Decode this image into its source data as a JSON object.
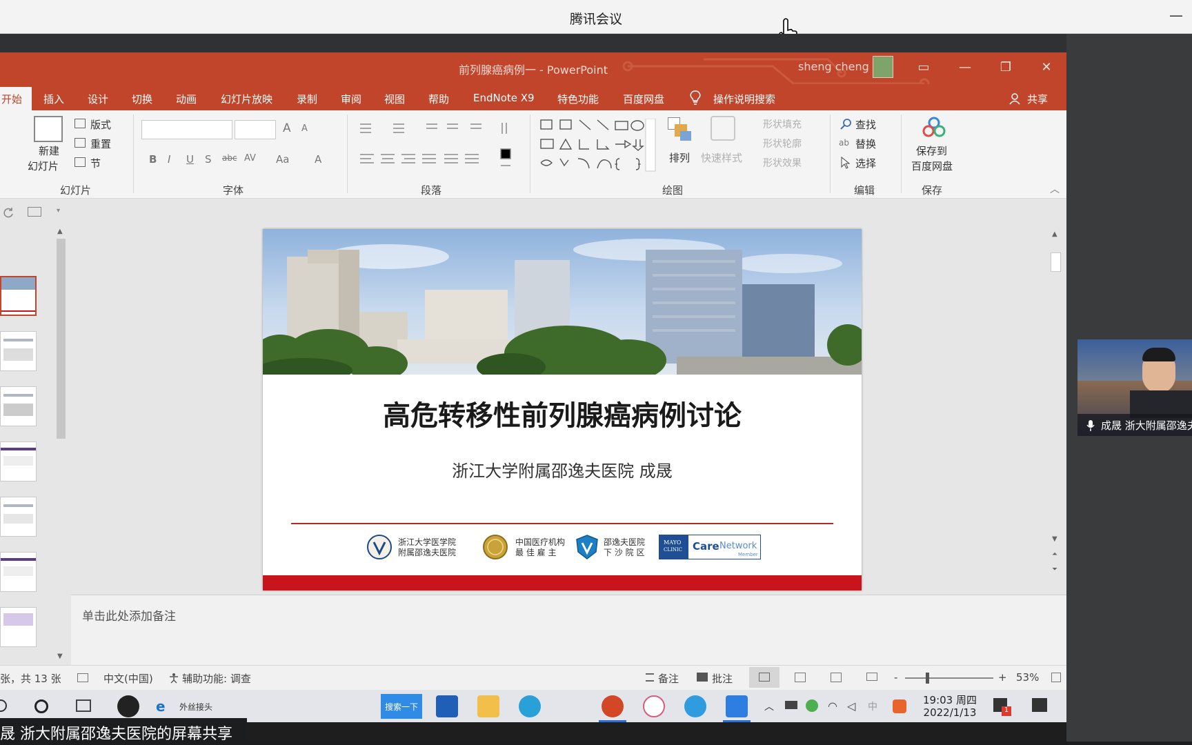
{
  "meeting": {
    "title": "腾讯会议",
    "share_banner": "晟 浙大附属邵逸夫医院的屏幕共享",
    "minimize_symbol": "—"
  },
  "window": {
    "title": "前列腺癌病例一 - PowerPoint",
    "user": "sheng cheng",
    "controls": [
      "▭",
      "—",
      "❐",
      "✕"
    ]
  },
  "tabs": [
    "开始",
    "插入",
    "设计",
    "切换",
    "动画",
    "幻灯片放映",
    "录制",
    "审阅",
    "视图",
    "帮助",
    "EndNote X9",
    "特色功能",
    "百度网盘"
  ],
  "tell_me": "操作说明搜索",
  "share_button": "共享",
  "ribbon": {
    "slides": {
      "label": "幻灯片",
      "new_slide": "新建",
      "new_slide_2": "幻灯片",
      "layout": "版式",
      "reset": "重置",
      "section": "节"
    },
    "font": {
      "label": "字体",
      "bold": "B",
      "italic": "I",
      "underline": "U",
      "shadow": "S",
      "strike": "abc",
      "spacing": "AV",
      "case": "Aa",
      "color": "A",
      "grow": "A",
      "shrink": "A"
    },
    "paragraph": {
      "label": "段落"
    },
    "drawing": {
      "label": "绘图",
      "arrange": "排列",
      "quick_styles": "快速样式",
      "shape_fill": "形状填充",
      "shape_outline": "形状轮廓",
      "shape_effect": "形状效果"
    },
    "editing": {
      "label": "编辑",
      "find": "查找",
      "replace": "替换",
      "select": "选择"
    },
    "save": {
      "label": "保存",
      "save_to": "保存到",
      "baidu": "百度网盘"
    }
  },
  "slide": {
    "title": "高危转移性前列腺癌病例讨论",
    "subtitle": "浙江大学附属邵逸夫医院 成晟",
    "logos": {
      "zju_1": "浙江大学医学院",
      "zju_2": "附属邵逸夫医院",
      "award_1": "中国医疗机构",
      "award_2": "最 佳 雇 主",
      "xiasha_1": "邵逸夫医院",
      "xiasha_2": "下 沙 院 区",
      "mayo_1": "MAYO",
      "mayo_2": "CLINIC",
      "care": "Care",
      "network": "Network",
      "member": "Member"
    }
  },
  "notes_placeholder": "单击此处添加备注",
  "status": {
    "slide_count": "张，共 13 张",
    "language": "中文(中国)",
    "accessibility": "辅助功能: 调查",
    "notes": "备注",
    "comments": "批注",
    "zoom": "53%",
    "zoom_minus": "-",
    "zoom_plus": "+"
  },
  "taskbar": {
    "search_label": "搜索一下",
    "ie_label": "外丝接头",
    "time": "19:03 周四",
    "date": "2022/1/13",
    "badge": "1"
  },
  "video": {
    "name": "成晟 浙大附属邵逸夫医院"
  },
  "colors": {
    "ppt_accent": "#c1452b",
    "slide_footer": "#c8151c"
  }
}
